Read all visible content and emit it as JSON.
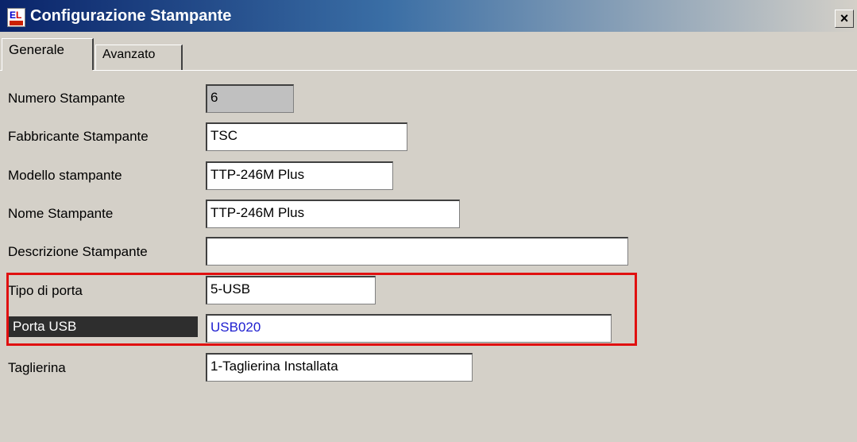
{
  "window": {
    "title": "Configurazione Stampante",
    "icon": "app-logo-icon",
    "close_label": "×"
  },
  "tabs": [
    {
      "label": "Generale",
      "active": true
    },
    {
      "label": "Avanzato",
      "active": false
    }
  ],
  "fields": {
    "numero_stampante": {
      "label": "Numero Stampante",
      "value": "6"
    },
    "fabbricante": {
      "label": "Fabbricante Stampante",
      "value": "TSC"
    },
    "modello": {
      "label": "Modello stampante",
      "value": "TTP-246M Plus"
    },
    "nome": {
      "label": "Nome Stampante",
      "value": "TTP-246M Plus"
    },
    "descrizione": {
      "label": "Descrizione Stampante",
      "value": ""
    },
    "tipo_porta": {
      "label": "Tipo di porta",
      "value": "5-USB"
    },
    "porta_usb": {
      "label": "Porta USB",
      "value": "USB020"
    },
    "taglierina": {
      "label": "Taglierina",
      "value": "1-Taglierina Installata"
    }
  },
  "colors": {
    "highlight_frame": "#e01010",
    "title_bar": "#0a246a",
    "usb_value": "#2020d0"
  }
}
